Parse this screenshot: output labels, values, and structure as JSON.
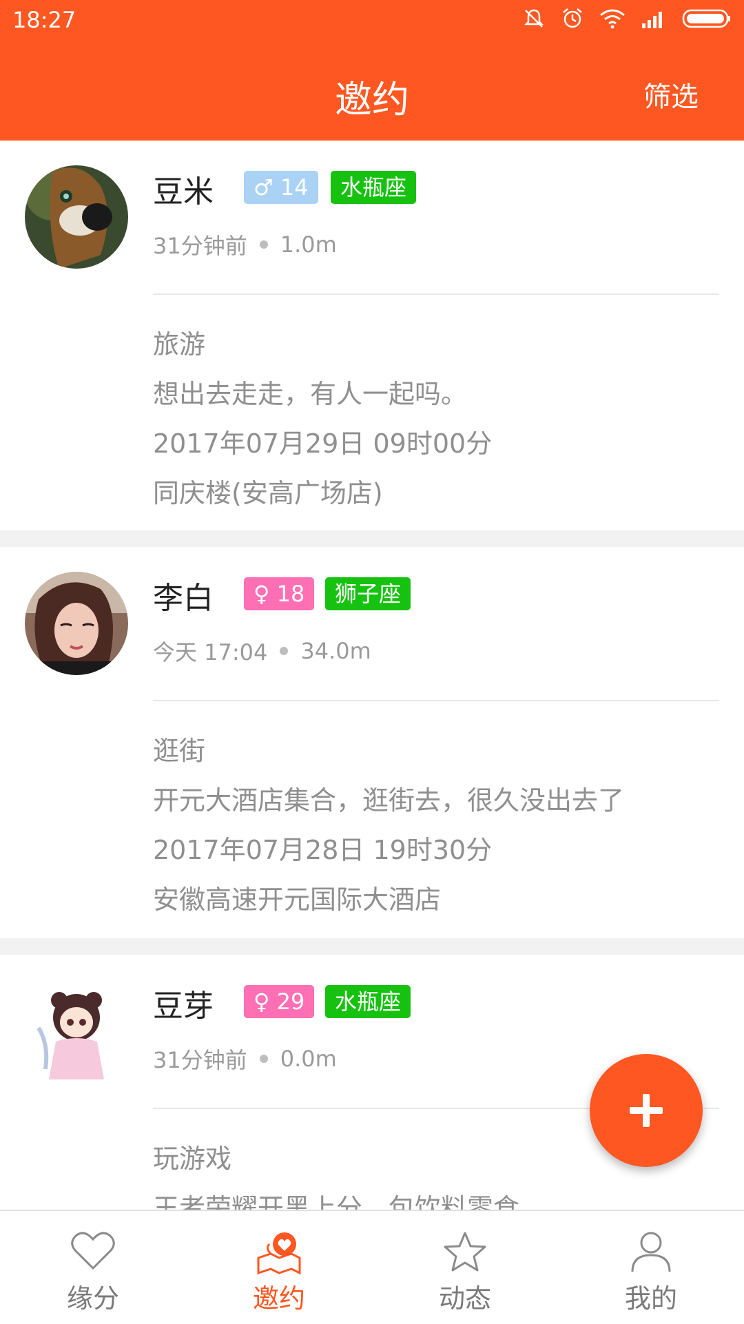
{
  "status_bar": {
    "time": "18:27"
  },
  "header": {
    "title": "邀约",
    "filter_label": "筛选"
  },
  "colors": {
    "accent": "#ff5722",
    "male_badge": "#a9d2f5",
    "female_badge": "#ff6fb4",
    "zodiac_badge": "#16c20f"
  },
  "posts": [
    {
      "name": "豆米",
      "gender_symbol": "♂",
      "age": "14",
      "zodiac": "水瓶座",
      "time": "31分钟前",
      "distance": "1.0m",
      "category": "旅游",
      "description": "想出去走走，有人一起吗。",
      "datetime": "2017年07月29日 09时00分",
      "location": "同庆楼(安高广场店)"
    },
    {
      "name": "李白",
      "gender_symbol": "♀",
      "age": "18",
      "zodiac": "狮子座",
      "time": "今天 17:04",
      "distance": "34.0m",
      "category": "逛街",
      "description": "开元大酒店集合，逛街去，很久没出去了",
      "datetime": "2017年07月28日 19时30分",
      "location": "安徽高速开元国际大酒店"
    },
    {
      "name": "豆芽",
      "gender_symbol": "♀",
      "age": "29",
      "zodiac": "水瓶座",
      "time": "31分钟前",
      "distance": "0.0m",
      "category": "玩游戏",
      "description": "王者荣耀开黑上分，包饮料零食"
    }
  ],
  "tabs": [
    {
      "label": "缘分",
      "icon": "heart-icon"
    },
    {
      "label": "邀约",
      "icon": "date-map-icon"
    },
    {
      "label": "动态",
      "icon": "star-icon"
    },
    {
      "label": "我的",
      "icon": "person-icon"
    }
  ],
  "fab": {
    "icon": "plus-icon"
  }
}
